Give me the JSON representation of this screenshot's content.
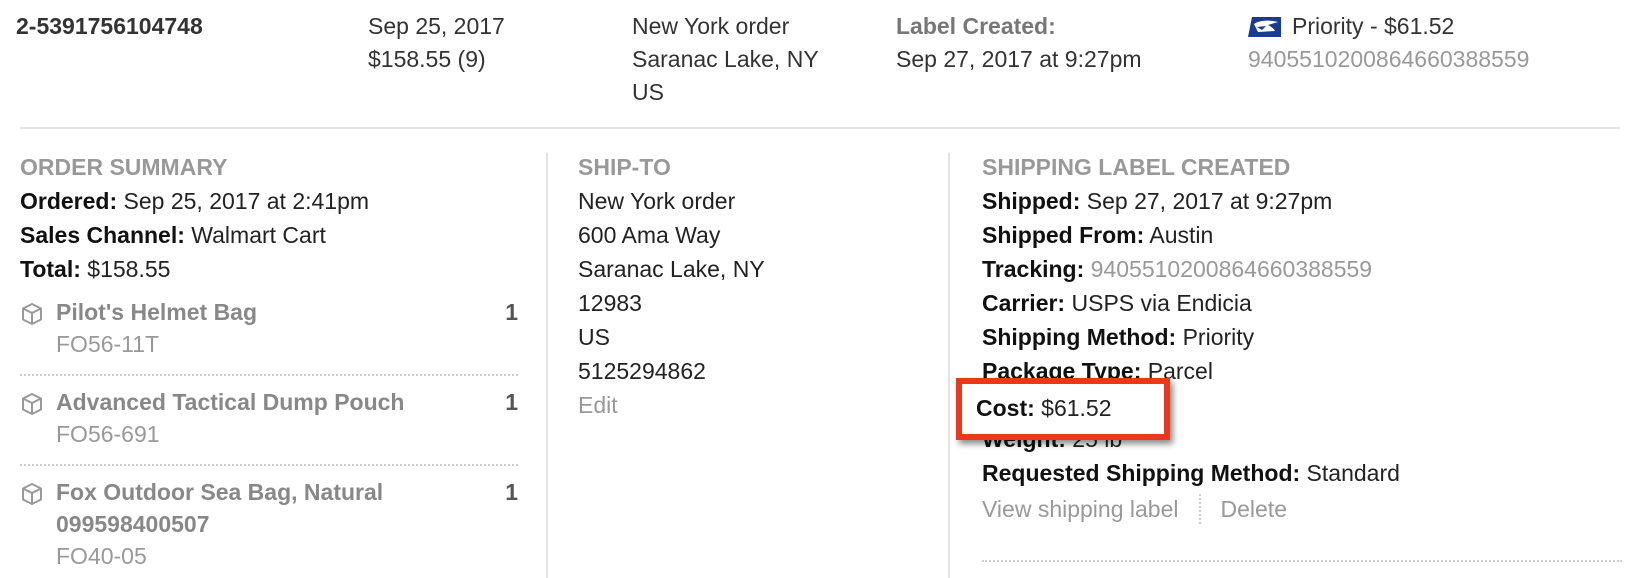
{
  "order": {
    "number": "2-5391756104748",
    "date": "Sep 25, 2017",
    "total_items": "$158.55 (9)",
    "shipto_name": "New York order",
    "shipto_city": "Saranac Lake, NY",
    "shipto_country": "US",
    "status_label": "Label Created:",
    "status_date": "Sep 27, 2017 at 9:27pm",
    "carrier_service": "Priority - $61.52",
    "tracking": "9405510200864660388559"
  },
  "summary": {
    "title": "ORDER SUMMARY",
    "ordered_label": "Ordered:",
    "ordered_value": "Sep 25, 2017 at 2:41pm",
    "channel_label": "Sales Channel:",
    "channel_value": "Walmart Cart",
    "total_label": "Total:",
    "total_value": "$158.55",
    "items": [
      {
        "name": "Pilot's Helmet Bag",
        "sku": "FO56-11T",
        "qty": "1"
      },
      {
        "name": "Advanced Tactical Dump Pouch",
        "sku": "FO56-691",
        "qty": "1"
      },
      {
        "name": "Fox Outdoor Sea Bag, Natural 099598400507",
        "sku": "FO40-05",
        "qty": "1"
      }
    ]
  },
  "shipto": {
    "title": "SHIP-TO",
    "name": "New York order",
    "street": "600 Ama Way",
    "city": "Saranac Lake, NY",
    "zip": "12983",
    "country": "US",
    "phone": "5125294862",
    "edit_label": "Edit"
  },
  "label": {
    "title": "SHIPPING LABEL CREATED",
    "shipped_label": "Shipped:",
    "shipped_value": "Sep 27, 2017 at 9:27pm",
    "from_label": "Shipped From:",
    "from_value": "Austin",
    "tracking_label": "Tracking:",
    "tracking_value": "9405510200864660388559",
    "carrier_label": "Carrier:",
    "carrier_value": "USPS via Endicia",
    "method_label": "Shipping Method:",
    "method_value": "Priority",
    "package_label": "Package Type:",
    "package_value": "Parcel",
    "cost_label": "Cost:",
    "cost_value": "$61.52",
    "weight_label": "Weight:",
    "weight_value": "25 lb",
    "requested_label": "Requested Shipping Method:",
    "requested_value": "Standard",
    "view_label": "View shipping label",
    "delete_label": "Delete"
  },
  "colors": {
    "highlight": "#e8391f",
    "muted": "#999999",
    "usps_blue": "#1a3c8f"
  },
  "icons": [
    "usps-logo-icon",
    "package-icon"
  ]
}
